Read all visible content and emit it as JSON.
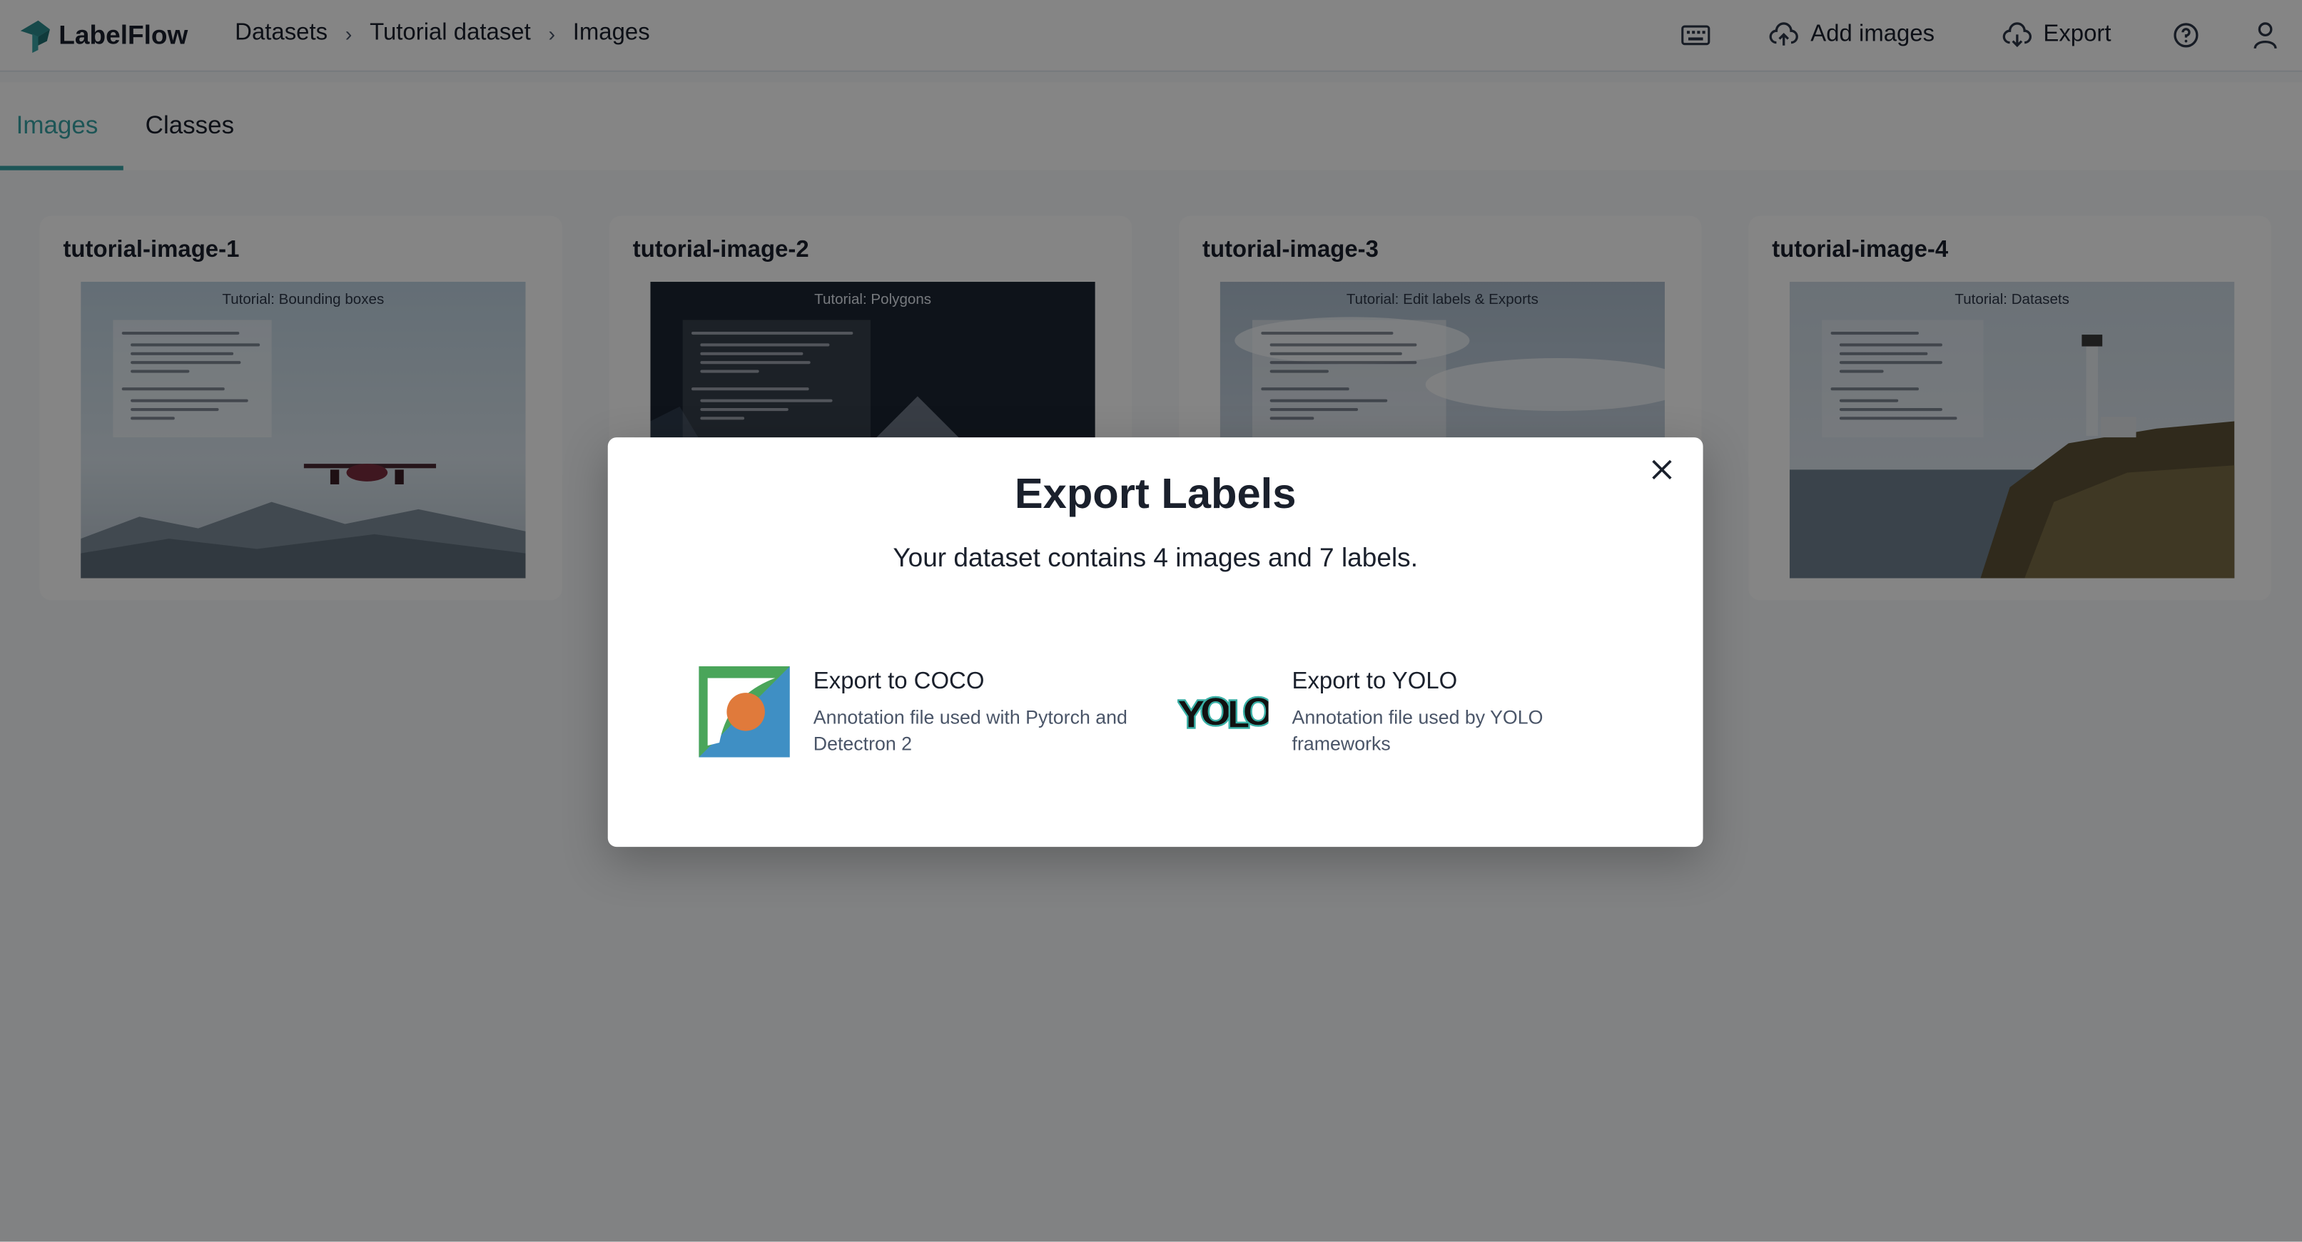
{
  "app": {
    "name": "LabelFlow"
  },
  "breadcrumb": [
    "Datasets",
    "Tutorial dataset",
    "Images"
  ],
  "toolbar": {
    "keyboard_icon": "keyboard-icon",
    "add_images_label": "Add images",
    "export_label": "Export",
    "help_icon": "help-circle-icon",
    "user_icon": "user-icon"
  },
  "tabs": [
    {
      "label": "Images",
      "active": true
    },
    {
      "label": "Classes",
      "active": false
    }
  ],
  "images": [
    {
      "name": "tutorial-image-1",
      "slide_title": "Tutorial: Bounding boxes"
    },
    {
      "name": "tutorial-image-2",
      "slide_title": "Tutorial: Polygons"
    },
    {
      "name": "tutorial-image-3",
      "slide_title": "Tutorial: Edit labels & Exports"
    },
    {
      "name": "tutorial-image-4",
      "slide_title": "Tutorial: Datasets"
    }
  ],
  "modal": {
    "title": "Export Labels",
    "subtitle": "Your dataset contains 4 images and 7 labels.",
    "options": [
      {
        "name": "Export to COCO",
        "description": "Annotation file used with Pytorch and Detectron 2",
        "icon": "coco-logo"
      },
      {
        "name": "Export to YOLO",
        "description": "Annotation file used by YOLO frameworks",
        "icon": "yolo-logo"
      }
    ]
  },
  "colors": {
    "accent": "#38a3a5",
    "overlay": "rgba(0,0,0,0.48)"
  }
}
